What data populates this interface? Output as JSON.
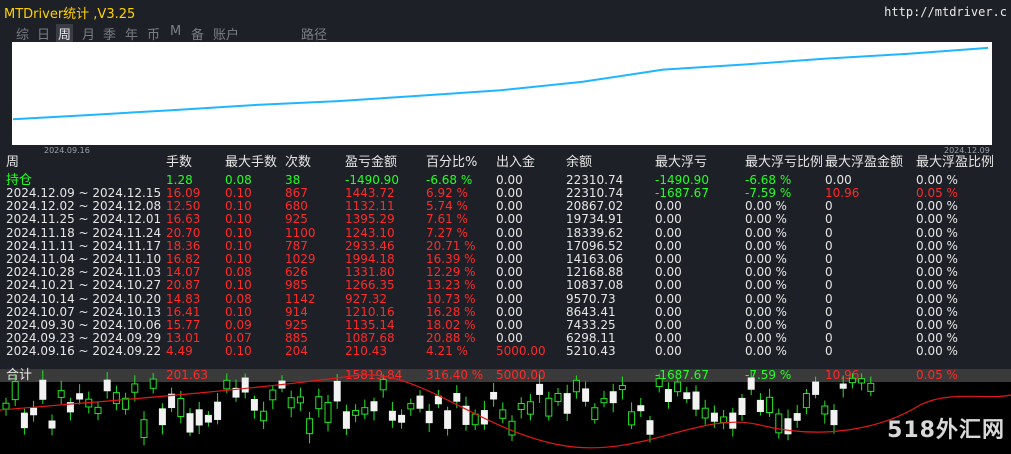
{
  "title": "MTDriver统计  ,V3.25",
  "url": "http://mtdriver.c",
  "tabs": [
    {
      "label": "综",
      "active": false
    },
    {
      "label": "日",
      "active": false
    },
    {
      "label": "周",
      "active": true
    },
    {
      "label": "月",
      "active": false
    },
    {
      "label": "季",
      "active": false
    },
    {
      "label": "年",
      "active": false
    },
    {
      "label": "币",
      "active": false
    },
    {
      "label": "M",
      "active": false
    },
    {
      "label": "备",
      "active": false
    },
    {
      "label": "账户",
      "active": false
    },
    {
      "label": "路径",
      "active": false
    }
  ],
  "chart": {
    "x_start_label": "2024.09.16",
    "x_end_label": "2024.12.09"
  },
  "chart_data": {
    "type": "line",
    "x": [
      "2024.09.16",
      "2024.09.23",
      "2024.09.30",
      "2024.10.07",
      "2024.10.14",
      "2024.10.21",
      "2024.10.28",
      "2024.11.04",
      "2024.11.11",
      "2024.11.18",
      "2024.11.25",
      "2024.12.02",
      "2024.12.09"
    ],
    "series": [
      {
        "values": [
          5210.43,
          6298.11,
          7433.25,
          8643.41,
          9570.73,
          10837.08,
          12168.88,
          14163.06,
          17096.52,
          18339.62,
          19734.91,
          20867.02,
          22310.74
        ]
      }
    ],
    "xlabel": "",
    "ylabel": "",
    "title": "",
    "line_color": "#1fb6ff"
  },
  "headers": [
    "周",
    "手数",
    "最大手数",
    "次数",
    "盈亏金额",
    "百分比%",
    "出入金",
    "余额",
    "最大浮亏",
    "最大浮亏比例",
    "最大浮盈金额",
    "最大浮盈比例"
  ],
  "holding": {
    "label": "持仓",
    "lots": "1.28",
    "max_lots": "0.08",
    "count": "38",
    "pnl": "-1490.90",
    "pct": "-6.68 %",
    "flow": "0.00",
    "balance": "22310.74",
    "max_float_loss": "-1490.90",
    "max_float_loss_pct": "-6.68 %",
    "max_float_profit": "0.00",
    "max_float_profit_pct": "0.00 %"
  },
  "rows": [
    {
      "period": "2024.12.09 ~ 2024.12.15",
      "lots": "16.09",
      "max_lots": "0.10",
      "count": "867",
      "pnl": "1443.72",
      "pct": "6.92 %",
      "flow": "0.00",
      "balance": "22310.74",
      "max_float_loss": "-1687.67",
      "max_float_loss_pct": "-7.59 %",
      "max_float_profit": "10.96",
      "max_float_profit_pct": "0.05 %"
    },
    {
      "period": "2024.12.02 ~ 2024.12.08",
      "lots": "12.50",
      "max_lots": "0.10",
      "count": "680",
      "pnl": "1132.11",
      "pct": "5.74 %",
      "flow": "0.00",
      "balance": "20867.02",
      "max_float_loss": "0.00",
      "max_float_loss_pct": "0.00 %",
      "max_float_profit": "0",
      "max_float_profit_pct": "0.00 %"
    },
    {
      "period": "2024.11.25 ~ 2024.12.01",
      "lots": "16.63",
      "max_lots": "0.10",
      "count": "925",
      "pnl": "1395.29",
      "pct": "7.61 %",
      "flow": "0.00",
      "balance": "19734.91",
      "max_float_loss": "0.00",
      "max_float_loss_pct": "0.00 %",
      "max_float_profit": "0",
      "max_float_profit_pct": "0.00 %"
    },
    {
      "period": "2024.11.18 ~ 2024.11.24",
      "lots": "20.70",
      "max_lots": "0.10",
      "count": "1100",
      "pnl": "1243.10",
      "pct": "7.27 %",
      "flow": "0.00",
      "balance": "18339.62",
      "max_float_loss": "0.00",
      "max_float_loss_pct": "0.00 %",
      "max_float_profit": "0",
      "max_float_profit_pct": "0.00 %"
    },
    {
      "period": "2024.11.11 ~ 2024.11.17",
      "lots": "18.36",
      "max_lots": "0.10",
      "count": "787",
      "pnl": "2933.46",
      "pct": "20.71 %",
      "flow": "0.00",
      "balance": "17096.52",
      "max_float_loss": "0.00",
      "max_float_loss_pct": "0.00 %",
      "max_float_profit": "0",
      "max_float_profit_pct": "0.00 %"
    },
    {
      "period": "2024.11.04 ~ 2024.11.10",
      "lots": "16.82",
      "max_lots": "0.10",
      "count": "1029",
      "pnl": "1994.18",
      "pct": "16.39 %",
      "flow": "0.00",
      "balance": "14163.06",
      "max_float_loss": "0.00",
      "max_float_loss_pct": "0.00 %",
      "max_float_profit": "0",
      "max_float_profit_pct": "0.00 %"
    },
    {
      "period": "2024.10.28 ~ 2024.11.03",
      "lots": "14.07",
      "max_lots": "0.08",
      "count": "626",
      "pnl": "1331.80",
      "pct": "12.29 %",
      "flow": "0.00",
      "balance": "12168.88",
      "max_float_loss": "0.00",
      "max_float_loss_pct": "0.00 %",
      "max_float_profit": "0",
      "max_float_profit_pct": "0.00 %"
    },
    {
      "period": "2024.10.21 ~ 2024.10.27",
      "lots": "20.87",
      "max_lots": "0.10",
      "count": "985",
      "pnl": "1266.35",
      "pct": "13.23 %",
      "flow": "0.00",
      "balance": "10837.08",
      "max_float_loss": "0.00",
      "max_float_loss_pct": "0.00 %",
      "max_float_profit": "0",
      "max_float_profit_pct": "0.00 %"
    },
    {
      "period": "2024.10.14 ~ 2024.10.20",
      "lots": "14.83",
      "max_lots": "0.08",
      "count": "1142",
      "pnl": "927.32",
      "pct": "10.73 %",
      "flow": "0.00",
      "balance": "9570.73",
      "max_float_loss": "0.00",
      "max_float_loss_pct": "0.00 %",
      "max_float_profit": "0",
      "max_float_profit_pct": "0.00 %"
    },
    {
      "period": "2024.10.07 ~ 2024.10.13",
      "lots": "16.41",
      "max_lots": "0.10",
      "count": "914",
      "pnl": "1210.16",
      "pct": "16.28 %",
      "flow": "0.00",
      "balance": "8643.41",
      "max_float_loss": "0.00",
      "max_float_loss_pct": "0.00 %",
      "max_float_profit": "0",
      "max_float_profit_pct": "0.00 %"
    },
    {
      "period": "2024.09.30 ~ 2024.10.06",
      "lots": "15.77",
      "max_lots": "0.09",
      "count": "925",
      "pnl": "1135.14",
      "pct": "18.02 %",
      "flow": "0.00",
      "balance": "7433.25",
      "max_float_loss": "0.00",
      "max_float_loss_pct": "0.00 %",
      "max_float_profit": "0",
      "max_float_profit_pct": "0.00 %"
    },
    {
      "period": "2024.09.23 ~ 2024.09.29",
      "lots": "13.01",
      "max_lots": "0.07",
      "count": "885",
      "pnl": "1087.68",
      "pct": "20.88 %",
      "flow": "0.00",
      "balance": "6298.11",
      "max_float_loss": "0.00",
      "max_float_loss_pct": "0.00 %",
      "max_float_profit": "0",
      "max_float_profit_pct": "0.00 %"
    },
    {
      "period": "2024.09.16 ~ 2024.09.22",
      "lots": "4.49",
      "max_lots": "0.10",
      "count": "204",
      "pnl": "210.43",
      "pct": "4.21 %",
      "flow": "5000.00",
      "balance": "5210.43",
      "max_float_loss": "0.00",
      "max_float_loss_pct": "0.00 %",
      "max_float_profit": "0",
      "max_float_profit_pct": "0.00 %"
    }
  ],
  "total": {
    "label": "合计",
    "lots": "201.63",
    "max_lots": "",
    "count": "",
    "pnl": "15819.84",
    "pct": "316.40 %",
    "flow": "5000.00",
    "balance": "",
    "max_float_loss": "-1687.67",
    "max_float_loss_pct": "-7.59 %",
    "max_float_profit": "10.96",
    "max_float_profit_pct": "0.05 %"
  },
  "watermark": "518外汇网"
}
